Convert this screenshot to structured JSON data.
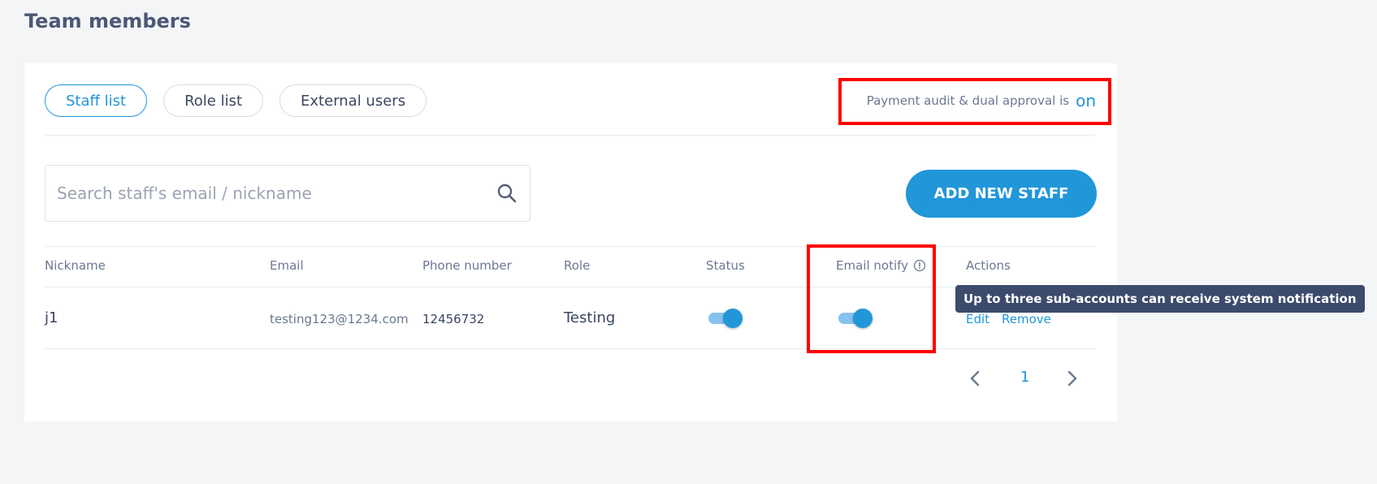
{
  "page": {
    "title": "Team members"
  },
  "tabs": [
    {
      "label": "Staff list",
      "active": true
    },
    {
      "label": "Role list",
      "active": false
    },
    {
      "label": "External users",
      "active": false
    }
  ],
  "audit": {
    "text": "Payment audit & dual approval is",
    "state": "on"
  },
  "search": {
    "placeholder": "Search staff's email / nickname",
    "value": ""
  },
  "add_button": {
    "label": "ADD NEW STAFF"
  },
  "table": {
    "headers": [
      "Nickname",
      "Email",
      "Phone number",
      "Role",
      "Status",
      "Email notify",
      "Actions"
    ],
    "rows": [
      {
        "nickname": "j1",
        "email": "testing123@1234.com",
        "phone": "12456732",
        "role": "Testing",
        "status_on": true,
        "email_notify_on": true,
        "actions": [
          "Edit",
          "Remove"
        ]
      }
    ]
  },
  "tooltip": {
    "text": "Up to three sub-accounts can receive system notification"
  },
  "pagination": {
    "current_page": "1"
  },
  "colors": {
    "accent": "#2196d9",
    "toggle_track": "#86c2ee",
    "tooltip_bg": "#3c4a6c",
    "highlight": "#ff0000",
    "page_bg": "#f4f5f7"
  },
  "icons": {
    "search": "search-icon",
    "info": "info-icon",
    "prev": "chevron-left-icon",
    "next": "chevron-right-icon"
  }
}
